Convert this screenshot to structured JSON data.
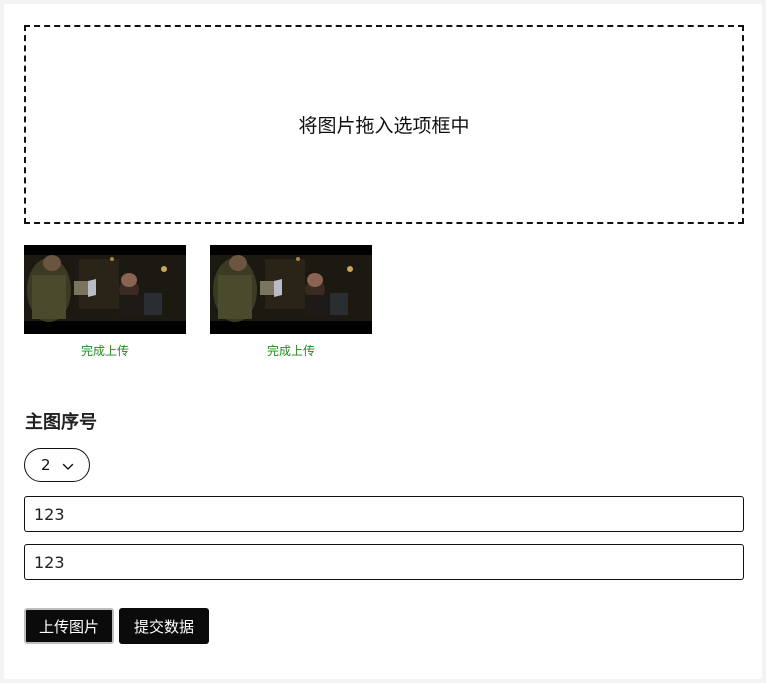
{
  "dropzone": {
    "text": "将图片拖入选项框中"
  },
  "thumbnails": [
    {
      "status": "完成上传"
    },
    {
      "status": "完成上传"
    }
  ],
  "main_image": {
    "title": "主图序号",
    "selected": "2"
  },
  "inputs": [
    {
      "value": "123"
    },
    {
      "value": "123"
    }
  ],
  "buttons": {
    "upload_label": "上传图片",
    "submit_label": "提交数据"
  },
  "colors": {
    "status_green": "#1f8a1f",
    "button_bg": "#0b0b0b"
  }
}
